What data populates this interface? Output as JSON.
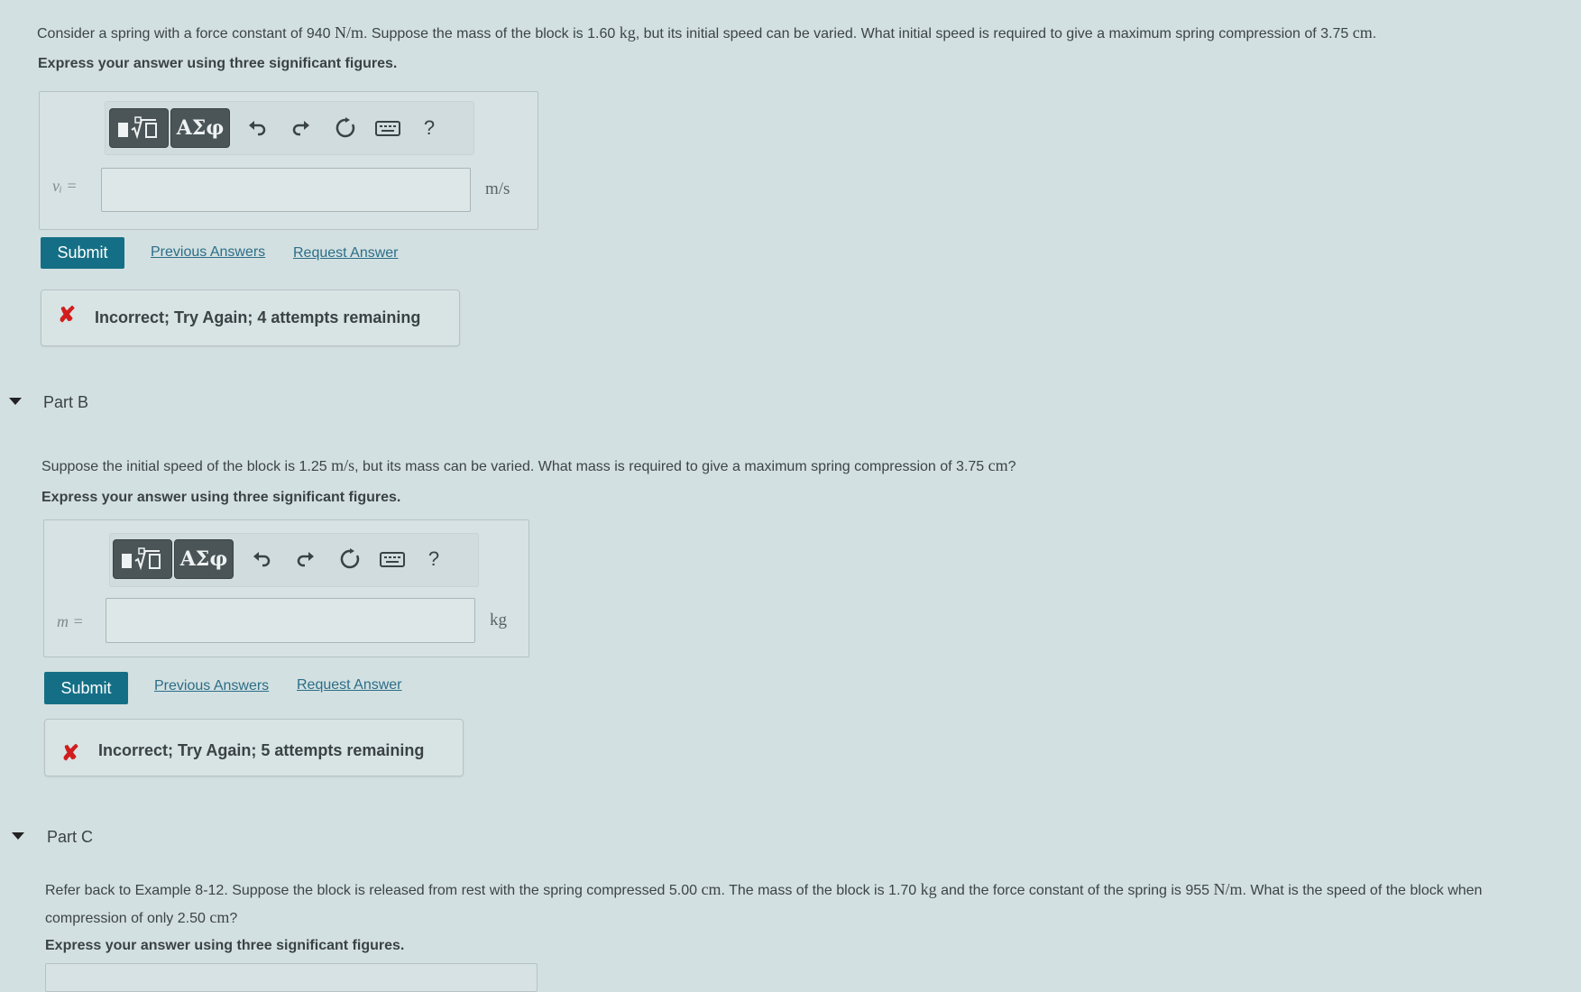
{
  "partA": {
    "question_1": "Consider a spring with a force constant of 940 ",
    "unit_Nm": "N/m",
    "question_2": ". Suppose the mass of the block is 1.60 ",
    "unit_kg": "kg",
    "question_3": ", but its initial speed can be varied. What initial speed is required to give a maximum spring compression of 3.75 ",
    "unit_cm": "cm",
    "question_4": ".",
    "instruction": "Express your answer using three significant figures.",
    "variable": "vᵢ =",
    "input_value": "",
    "unit": "m/s",
    "submit": "Submit",
    "previous": "Previous Answers",
    "request": "Request Answer",
    "feedback": "Incorrect; Try Again; 4 attempts remaining"
  },
  "partB": {
    "title": "Part B",
    "question_1": "Suppose the initial speed of the block is 1.25 ",
    "unit_ms": "m/s",
    "question_2": ", but its mass can be varied. What mass is required to give a maximum spring compression of 3.75 ",
    "unit_cm": "cm",
    "question_3": "?",
    "instruction": "Express your answer using three significant figures.",
    "variable": "m =",
    "input_value": "",
    "unit": "kg",
    "submit": "Submit",
    "previous": "Previous Answers",
    "request": "Request Answer",
    "feedback": "Incorrect; Try Again; 5 attempts remaining"
  },
  "partC": {
    "title": "Part C",
    "question_line1_a": "Refer back to Example 8-12. Suppose the block is released from rest with the spring compressed 5.00 ",
    "unit_cm": "cm",
    "question_line1_b": ". The mass of the block is 1.70 ",
    "unit_kg": "kg",
    "question_line1_c": " and the force constant of the spring is 955 ",
    "unit_Nm": "N/m",
    "question_line1_d": ". What is the speed of the block when",
    "question_line2_a": "compression of only 2.50 ",
    "unit_cm2": "cm",
    "question_line2_b": "?",
    "instruction": "Express your answer using three significant figures."
  },
  "toolbar": {
    "templates_icon": "templates-icon",
    "greek_label": "ΑΣφ",
    "undo_icon": "undo-icon",
    "redo_icon": "redo-icon",
    "reset_icon": "reset-icon",
    "keyboard_icon": "keyboard-icon",
    "help_label": "?"
  },
  "colors": {
    "background": "#d3e0e1",
    "submit": "#146f86",
    "link": "#2b6e88",
    "error": "#d11d1d"
  }
}
